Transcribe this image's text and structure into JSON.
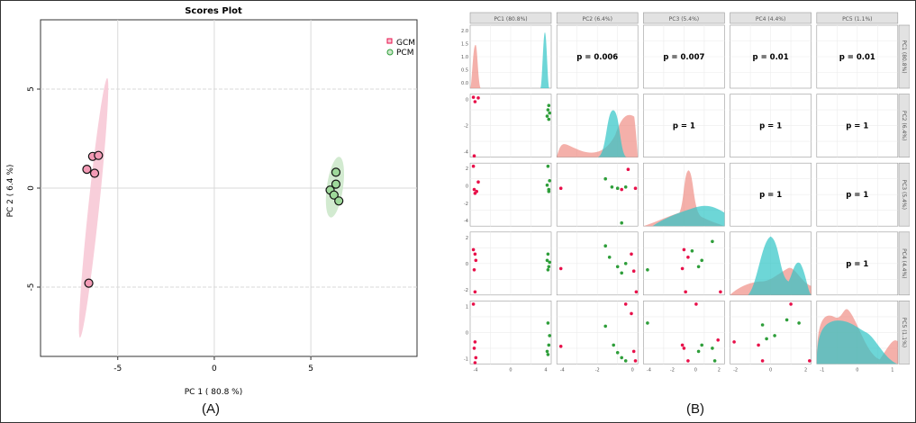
{
  "labels": {
    "panel_a": "(A)",
    "panel_b": "(B)"
  },
  "colors": {
    "gcm": "#e8104a",
    "pcm": "#2e9e3a",
    "gcm_fill": "#f7c5d4",
    "pcm_fill": "#cde8cb",
    "gcm_density": "#f08f86",
    "pcm_density": "#2fc4c6"
  },
  "chart_data": [
    {
      "type": "scatter",
      "title": "Scores Plot",
      "xlabel": "PC 1 ( 80.8 %)",
      "ylabel": "PC 2 ( 6.4 %)",
      "xlim": [
        -9,
        10.5
      ],
      "ylim": [
        -8.5,
        8.5
      ],
      "x_ticks": [
        -5,
        0,
        5
      ],
      "y_ticks": [
        -5,
        0,
        5
      ],
      "tick_labels_x": [
        "-5",
        "0",
        "5"
      ],
      "tick_labels_y": [
        "-5",
        "0",
        "5"
      ],
      "grid": true,
      "legend_position": "top-right",
      "series": [
        {
          "name": "GCM",
          "points": [
            [
              -6.3,
              1.6
            ],
            [
              -6.0,
              1.65
            ],
            [
              -6.6,
              0.95
            ],
            [
              -6.2,
              0.75
            ],
            [
              -6.5,
              -4.8
            ]
          ]
        },
        {
          "name": "PCM",
          "points": [
            [
              6.3,
              0.8
            ],
            [
              6.0,
              -0.1
            ],
            [
              6.3,
              0.2
            ],
            [
              6.2,
              -0.35
            ],
            [
              6.45,
              -0.65
            ]
          ]
        }
      ]
    },
    {
      "type": "scatter",
      "title": "",
      "strip_labels": [
        "PC1 (80.8%)",
        "PC2 (6.4%)",
        "PC3 (5.4%)",
        "PC4 (4.4%)",
        "PC5 (1.1%)"
      ],
      "p_values": [
        {
          "row": 1,
          "col": 2,
          "label": "p = 0.006"
        },
        {
          "row": 1,
          "col": 3,
          "label": "p = 0.007"
        },
        {
          "row": 1,
          "col": 4,
          "label": "p = 0.01"
        },
        {
          "row": 1,
          "col": 5,
          "label": "p = 0.01"
        },
        {
          "row": 2,
          "col": 3,
          "label": "p = 1"
        },
        {
          "row": 2,
          "col": 4,
          "label": "p = 1"
        },
        {
          "row": 2,
          "col": 5,
          "label": "p = 1"
        },
        {
          "row": 3,
          "col": 4,
          "label": "p = 1"
        },
        {
          "row": 3,
          "col": 5,
          "label": "p = 1"
        },
        {
          "row": 4,
          "col": 5,
          "label": "p = 1"
        }
      ],
      "y_tick_labels": [
        [
          "2.0",
          "1.5",
          "1.0",
          "0.5",
          "0.0"
        ],
        [
          "0",
          "-2",
          "-4"
        ],
        [
          "2",
          "0",
          "-2",
          "-4"
        ],
        [
          "2",
          "0",
          "-2"
        ],
        [
          "1",
          "0",
          "-1"
        ]
      ],
      "x_tick_labels": [
        [
          "-4",
          "0",
          "4"
        ],
        [
          "-4",
          "-2",
          "0"
        ],
        [
          "-4",
          "-2",
          "0",
          "2"
        ],
        [
          "-2",
          "0",
          "2"
        ],
        [
          "-1",
          "0",
          "1"
        ]
      ]
    }
  ]
}
